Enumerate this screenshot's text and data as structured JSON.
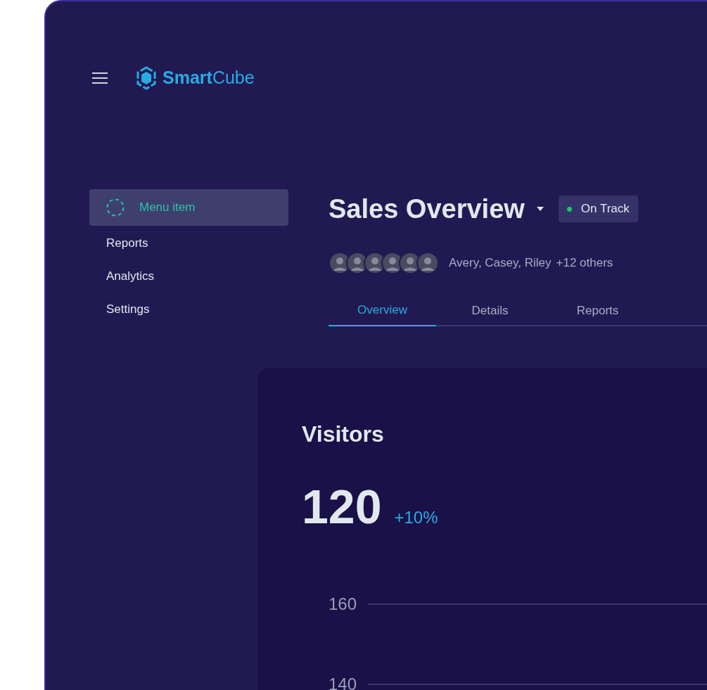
{
  "header": {
    "logo_bold": "Smart",
    "logo_light": "Cube"
  },
  "sidebar": {
    "items": [
      {
        "label": "Menu item",
        "selected": true
      },
      {
        "label": "Reports",
        "selected": false
      },
      {
        "label": "Analytics",
        "selected": false
      },
      {
        "label": "Settings",
        "selected": false
      }
    ]
  },
  "page": {
    "title": "Sales Overview",
    "status": {
      "label": "On Track",
      "color": "#22c55e"
    },
    "avatars": [
      {
        "kind": "photo"
      },
      {
        "kind": "photo"
      },
      {
        "kind": "photo"
      },
      {
        "kind": "photo"
      },
      {
        "kind": "photo"
      },
      {
        "kind": "photo"
      }
    ],
    "members": "Avery, Casey, Riley",
    "others": "+12 others"
  },
  "tabs": [
    {
      "label": "Overview",
      "selected": true
    },
    {
      "label": "Details",
      "selected": false
    },
    {
      "label": "Reports",
      "selected": false
    }
  ],
  "card": {
    "title": "Visitors",
    "value": "120",
    "change": "+10%",
    "y_labels": [
      "160",
      "140"
    ]
  }
}
